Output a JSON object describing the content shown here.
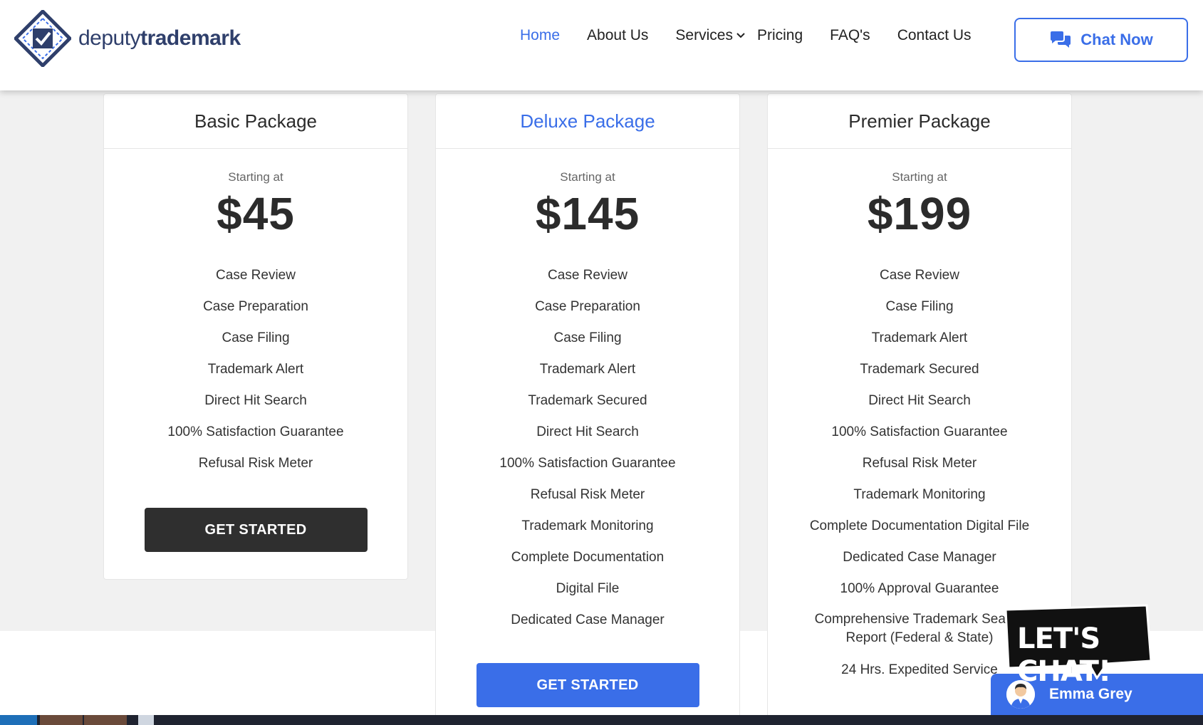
{
  "brand": {
    "name_light": "deputy",
    "name_bold": "trademark",
    "logo_icon": "checkbox-diamond-icon"
  },
  "nav": {
    "items": [
      {
        "label": "Home",
        "active": true
      },
      {
        "label": "About Us"
      },
      {
        "label": "Services",
        "has_dropdown": true
      },
      {
        "label": "Pricing"
      },
      {
        "label": "FAQ's"
      },
      {
        "label": "Contact Us"
      }
    ],
    "chat_label": "Chat Now",
    "chat_icon": "chat-bubbles-icon"
  },
  "packages": [
    {
      "name": "Basic Package",
      "starting": "Starting at",
      "price": "$45",
      "features": [
        "Case Review",
        "Case Preparation",
        "Case Filing",
        "Trademark Alert",
        "Direct Hit Search",
        "100% Satisfaction Guarantee",
        "Refusal Risk Meter"
      ],
      "cta": "GET STARTED"
    },
    {
      "name": "Deluxe Package",
      "starting": "Starting at",
      "price": "$145",
      "features": [
        "Case Review",
        "Case Preparation",
        "Case Filing",
        "Trademark Alert",
        "Trademark Secured",
        "Direct Hit Search",
        "100% Satisfaction Guarantee",
        "Refusal Risk Meter",
        "Trademark Monitoring",
        "Complete Documentation",
        "Digital File",
        "Dedicated Case Manager"
      ],
      "cta": "GET STARTED"
    },
    {
      "name": "Premier Package",
      "starting": "Starting at",
      "price": "$199",
      "features": [
        "Case Review",
        "Case Filing",
        "Trademark Alert",
        "Trademark Secured",
        "Direct Hit Search",
        "100% Satisfaction Guarantee",
        "Refusal Risk Meter",
        "Trademark Monitoring",
        "Complete Documentation Digital File",
        "Dedicated Case Manager",
        "100% Approval Guarantee",
        "Comprehensive Trademark Search Report (Federal & State)",
        "24 Hrs. Expedited Service"
      ]
    }
  ],
  "chat_widget": {
    "bubble_text": "LET'S CHAT!",
    "agent_name": "Emma Grey"
  },
  "colors": {
    "accent": "#3a6ee8",
    "dark_button": "#2f2f2f",
    "band": "#f1f1f1"
  }
}
